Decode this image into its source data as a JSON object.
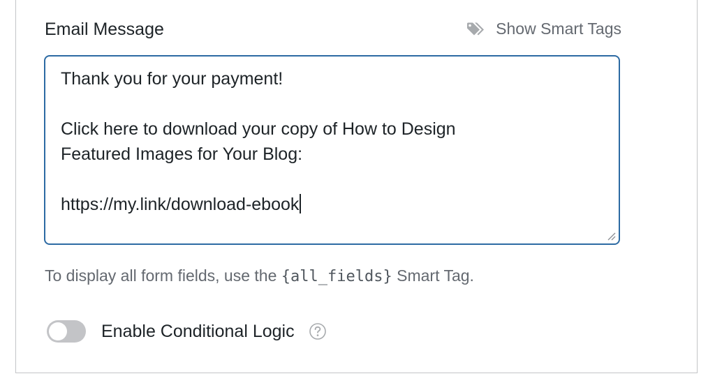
{
  "email_message": {
    "label": "Email Message",
    "smart_tags_link": "Show Smart Tags",
    "smart_tags_icon": "tag-icon",
    "message_lines": [
      "Thank you for your payment!",
      "",
      "Click here to download your copy of How to Design",
      "Featured Images for Your Blog:",
      "",
      "https://my.link/download-ebook"
    ],
    "help_prefix": "To display all form fields, use the ",
    "help_code": "{all_fields}",
    "help_suffix": " Smart Tag."
  },
  "conditional_logic": {
    "label": "Enable Conditional Logic",
    "enabled": false,
    "help_icon": "question-circle-icon"
  },
  "colors": {
    "focus_border": "#2c6aa3",
    "toggle_off": "#c3c4c7",
    "muted_text": "#646970"
  }
}
